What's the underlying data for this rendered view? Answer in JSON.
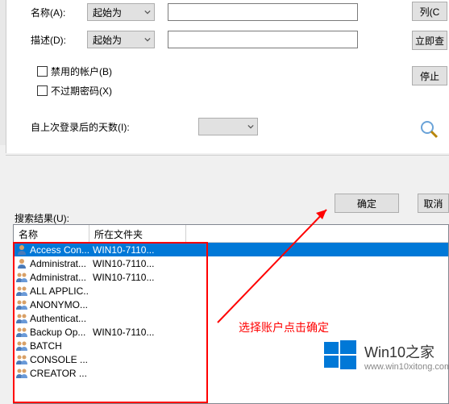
{
  "form": {
    "name_label": "名称(A):",
    "name_op": "起始为",
    "name_value": "",
    "desc_label": "描述(D):",
    "desc_op": "起始为",
    "desc_value": "",
    "chk_disabled": "禁用的帐户(B)",
    "chk_noexpire": "不过期密码(X)",
    "days_label": "自上次登录后的天数(I):",
    "days_value": ""
  },
  "buttons": {
    "columns": "列(C",
    "search_now": "立即查",
    "stop": "停止",
    "ok": "确定",
    "cancel": "取消"
  },
  "results": {
    "label": "搜索结果(U):",
    "col_name": "名称",
    "col_folder": "所在文件夹",
    "rows": [
      {
        "icon": "user",
        "name": "Access Con...",
        "folder": "WIN10-7110...",
        "selected": true
      },
      {
        "icon": "user",
        "name": "Administrat...",
        "folder": "WIN10-7110..."
      },
      {
        "icon": "group",
        "name": "Administrat...",
        "folder": "WIN10-7110..."
      },
      {
        "icon": "group",
        "name": "ALL APPLIC...",
        "folder": ""
      },
      {
        "icon": "group",
        "name": "ANONYMO...",
        "folder": ""
      },
      {
        "icon": "group",
        "name": "Authenticat...",
        "folder": ""
      },
      {
        "icon": "group",
        "name": "Backup Op...",
        "folder": "WIN10-7110..."
      },
      {
        "icon": "group",
        "name": "BATCH",
        "folder": ""
      },
      {
        "icon": "group",
        "name": "CONSOLE ...",
        "folder": ""
      },
      {
        "icon": "group",
        "name": "CREATOR ...",
        "folder": ""
      }
    ]
  },
  "annotation": {
    "text": "选择账户点击确定"
  },
  "watermark": {
    "title": "Win10之家",
    "url": "www.win10xitong.com"
  }
}
